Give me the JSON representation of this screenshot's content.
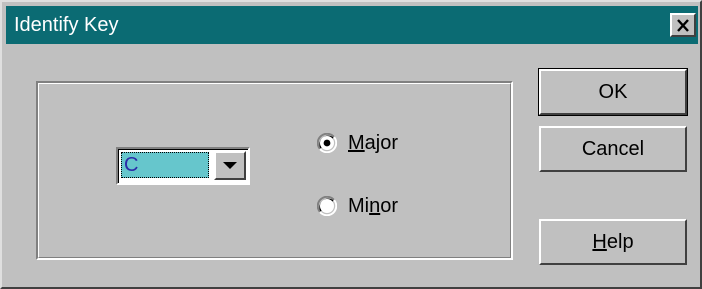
{
  "window": {
    "title": "Identify Key",
    "titlebar_color": "#0b6b73",
    "close_icon": "close-icon"
  },
  "key_select": {
    "value": "C",
    "selected_highlight": "#66c6cc",
    "arrow_icon": "dropdown-arrow-icon"
  },
  "mode": {
    "major": {
      "pre": "",
      "mnemonic": "M",
      "post": "ajor",
      "checked": true
    },
    "minor": {
      "pre": "Mi",
      "mnemonic": "n",
      "post": "or",
      "checked": false
    }
  },
  "buttons": {
    "ok": "OK",
    "cancel": "Cancel",
    "help_mnemonic": "H",
    "help_rest": "elp"
  }
}
